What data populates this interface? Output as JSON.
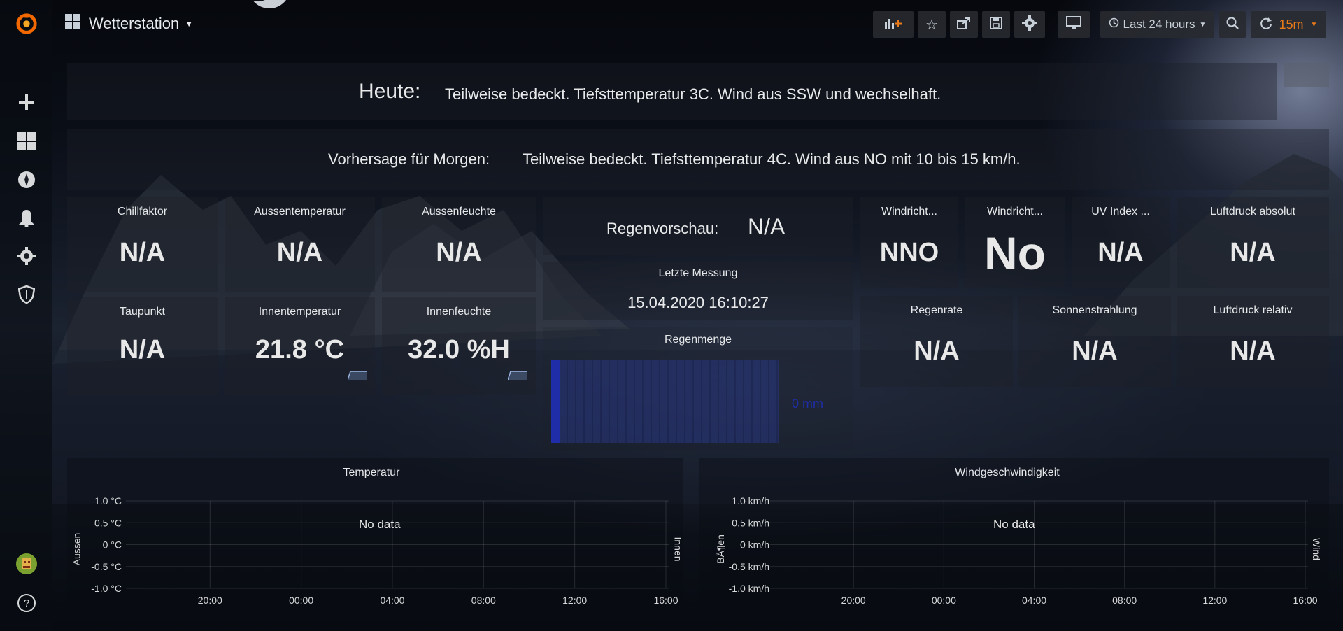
{
  "nav": {
    "dashboard_title": "Wetterstation",
    "time_range": "Last 24 hours",
    "refresh_interval": "15m",
    "logo_icon": "grafana-logo-icon",
    "buttons": [
      "add-panel-icon",
      "star-icon",
      "share-icon",
      "save-icon",
      "settings-icon",
      "tv-mode-icon",
      "zoom-out-icon",
      "refresh-icon"
    ]
  },
  "sidemenu": {
    "items": [
      "plus-icon",
      "dashboards-icon",
      "explore-compass-icon",
      "alerting-bell-icon",
      "configuration-gear-icon",
      "server-admin-shield-icon"
    ],
    "bottom": [
      "user-avatar",
      "help-icon"
    ]
  },
  "forecast": {
    "today_label": "Heute:",
    "today_text": "Teilweise bedeckt. Tiefsttemperatur 3C. Wind aus SSW und wechselhaft.",
    "tomorrow_label": "Vorhersage für Morgen:",
    "tomorrow_text": "Teilweise bedeckt. Tiefsttemperatur 4C. Wind aus NO mit 10 bis 15 km/h."
  },
  "stats": {
    "chillfaktor": {
      "title": "Chillfaktor",
      "value": "N/A"
    },
    "aussentemperatur": {
      "title": "Aussentemperatur",
      "value": "N/A"
    },
    "aussenfeuchte": {
      "title": "Aussenfeuchte",
      "value": "N/A"
    },
    "taupunkt": {
      "title": "Taupunkt",
      "value": "N/A"
    },
    "innentemperatur": {
      "title": "Innentemperatur",
      "value": "21.8 °C"
    },
    "innenfeuchte": {
      "title": "Innenfeuchte",
      "value": "32.0 %H"
    },
    "regenvorschau": {
      "title": "Regenvorschau:",
      "value": "N/A"
    },
    "letzte_messung": {
      "title": "Letzte Messung",
      "value": "15.04.2020 16:10:27"
    },
    "windrichtung1": {
      "title": "Windricht...",
      "value": "NNO"
    },
    "windrichtung2": {
      "title": "Windricht...",
      "value": "No"
    },
    "uv_index": {
      "title": "UV Index ...",
      "value": "N/A"
    },
    "luftdruck_absolut": {
      "title": "Luftdruck absolut",
      "value": "N/A"
    },
    "regenrate": {
      "title": "Regenrate",
      "value": "N/A"
    },
    "sonnenstrahlung": {
      "title": "Sonnenstrahlung",
      "value": "N/A"
    },
    "luftdruck_relativ": {
      "title": "Luftdruck relativ",
      "value": "N/A"
    }
  },
  "regenmenge": {
    "title": "Regenmenge",
    "value": "0 mm",
    "fill_fraction": 0.0
  },
  "charts": {
    "temperatur": {
      "title": "Temperatur",
      "left_axis": "Aussen",
      "right_axis": "Innen",
      "no_data": "No data",
      "y_ticks": [
        "1.0 °C",
        "0.5 °C",
        "0 °C",
        "-0.5 °C",
        "-1.0 °C"
      ],
      "x_ticks": [
        "20:00",
        "00:00",
        "04:00",
        "08:00",
        "12:00",
        "16:00"
      ]
    },
    "wind": {
      "title": "Windgeschwindigkeit",
      "left_axis": "BÃ¶en",
      "right_axis": "Wind",
      "no_data": "No data",
      "y_ticks": [
        "1.0 km/h",
        "0.5 km/h",
        "0 km/h",
        "-0.5 km/h",
        "-1.0 km/h"
      ],
      "x_ticks": [
        "20:00",
        "00:00",
        "04:00",
        "08:00",
        "12:00",
        "16:00"
      ]
    }
  },
  "colors": {
    "accent": "#eb7b18",
    "bar": "#1f2ea8",
    "panel_text": "#e8e8e8"
  }
}
